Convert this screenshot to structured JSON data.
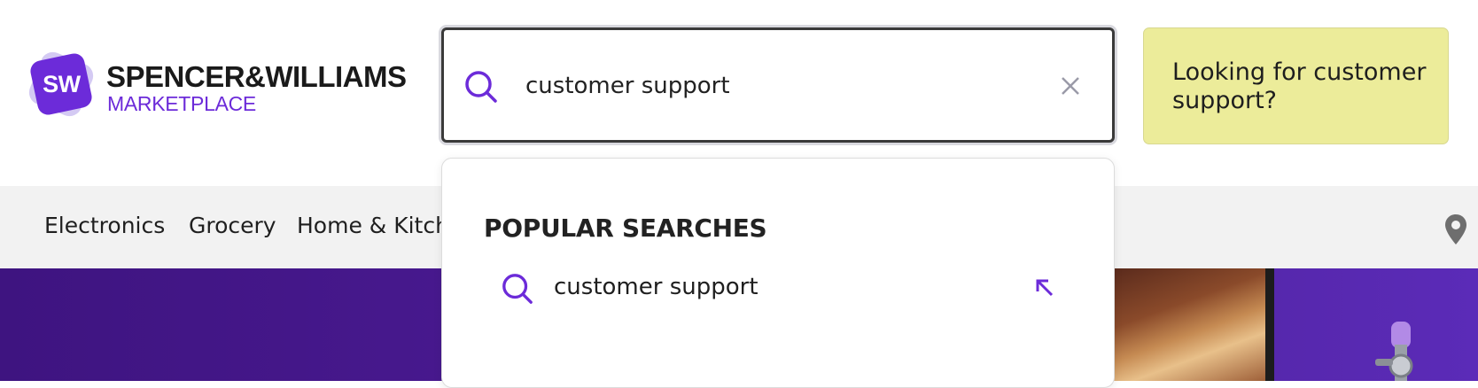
{
  "header": {
    "logo": {
      "mark_text": "SW",
      "title": "SPENCER&WILLIAMS",
      "subtitle": "MARKETPLACE"
    },
    "search": {
      "value": "customer support",
      "placeholder": ""
    },
    "promo": {
      "text": "Looking for customer support?"
    }
  },
  "nav": {
    "items": [
      "Electronics",
      "Grocery",
      "Home & Kitchen"
    ]
  },
  "dropdown": {
    "heading": "POPULAR SEARCHES",
    "suggestions": [
      {
        "label": "customer support"
      }
    ]
  },
  "icons": {
    "search": "search-icon",
    "clear": "close-icon",
    "location": "location-pin-icon",
    "fill_suggestion": "arrow-up-left-icon"
  },
  "colors": {
    "brand": "#6c2bd9",
    "promo_bg": "#ecec9a",
    "hero": "#4a1a92",
    "nav_bg": "#f2f2f2"
  }
}
